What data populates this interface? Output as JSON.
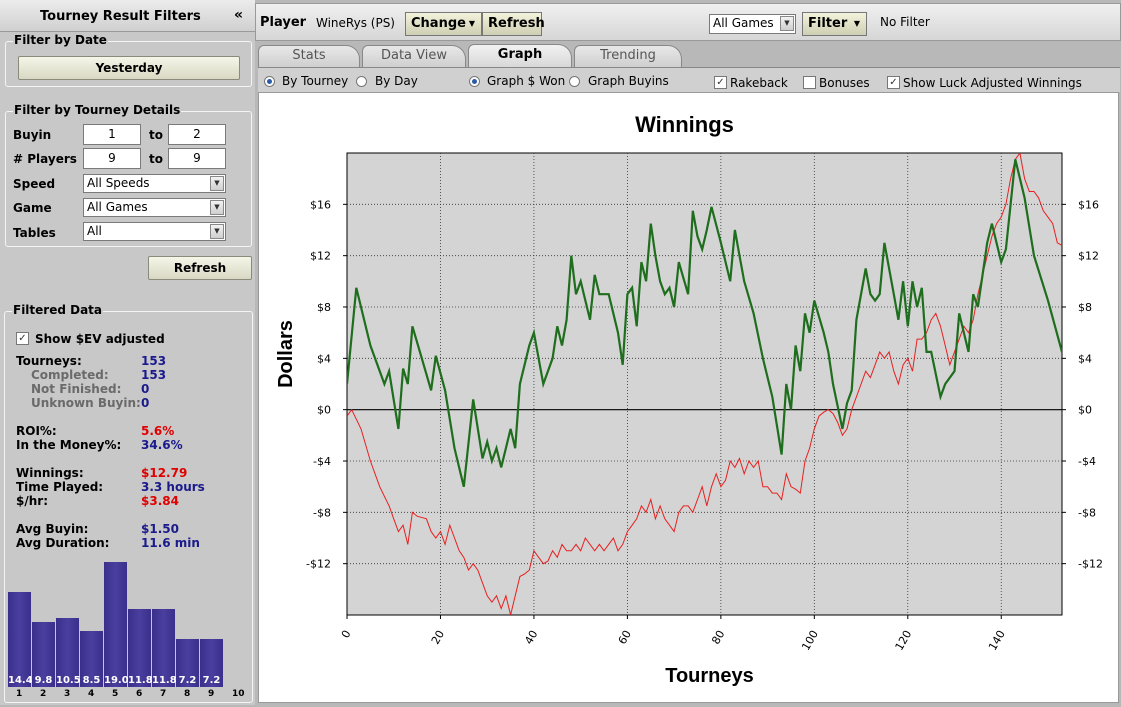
{
  "left_panel": {
    "title": "Tourney Result Filters",
    "collapse_glyph": "«",
    "filter_by_date": {
      "label": "Filter by Date",
      "button": "Yesterday"
    },
    "filter_by_details": {
      "label": "Filter by Tourney Details",
      "buyin": {
        "label": "Buyin",
        "from": "1",
        "to_label": "to",
        "to": "2"
      },
      "players": {
        "label": "# Players",
        "from": "9",
        "to_label": "to",
        "to": "9"
      },
      "speed": {
        "label": "Speed",
        "value": "All Speeds"
      },
      "game": {
        "label": "Game",
        "value": "All Games"
      },
      "tables": {
        "label": "Tables",
        "value": "All"
      }
    },
    "refresh": "Refresh",
    "filtered_data": {
      "label": "Filtered Data",
      "show_sev": "Show $EV adjusted",
      "show_sev_checked": true,
      "check_glyph": "✓",
      "tourneys_label": "Tourneys:",
      "tourneys": "153",
      "completed_label": "Completed:",
      "completed": "153",
      "not_finished_label": "Not Finished:",
      "not_finished": "0",
      "unknown_buyin_label": "Unknown Buyin:",
      "unknown_buyin": "0",
      "roi_label": "ROI%:",
      "roi": "5.6%",
      "itm_label": "In the Money%:",
      "itm": "34.6%",
      "winnings_label": "Winnings:",
      "winnings": "$12.79",
      "time_label": "Time Played:",
      "time": "3.3 hours",
      "hourly_label": "$/hr:",
      "hourly": "$3.84",
      "avg_buyin_label": "Avg Buyin:",
      "avg_buyin": "$1.50",
      "avg_duration_label": "Avg Duration:",
      "avg_duration": "11.6 min"
    },
    "finish_histogram": {
      "positions": [
        "1",
        "2",
        "3",
        "4",
        "5",
        "6",
        "7",
        "8",
        "9",
        "10"
      ],
      "values": [
        14.4,
        9.8,
        10.5,
        8.5,
        19.0,
        11.8,
        11.8,
        7.2,
        7.2,
        null
      ],
      "labels": [
        "14.4",
        "9.8",
        "10.5",
        "8.5",
        "19.0",
        "11.8",
        "11.8",
        "7.2",
        "7.2",
        ""
      ],
      "color": "#3d3290"
    }
  },
  "topbar": {
    "player_label": "Player",
    "player_value": "WineRys (PS)",
    "change": "Change",
    "refresh": "Refresh",
    "games_select": "All Games",
    "filter": "Filter",
    "filter_status": "No Filter",
    "dropdown_glyph": "▼"
  },
  "tabs": [
    {
      "label": "Stats",
      "active": false
    },
    {
      "label": "Data View",
      "active": false
    },
    {
      "label": "Graph",
      "active": true
    },
    {
      "label": "Trending",
      "active": false
    }
  ],
  "options": {
    "by_tourney": "By Tourney",
    "by_tourney_on": true,
    "by_day": "By Day",
    "by_day_on": false,
    "graph_won": "Graph $ Won",
    "graph_won_on": true,
    "graph_buyins": "Graph Buyins",
    "graph_buyins_on": false,
    "rakeback": "Rakeback",
    "rakeback_checked": true,
    "bonuses": "Bonuses",
    "bonuses_checked": false,
    "luck_adjusted": "Show Luck Adjusted Winnings",
    "luck_adjusted_checked": true,
    "check_glyph": "✓"
  },
  "chart_data": {
    "type": "line",
    "title": "Winnings",
    "xlabel": "Tourneys",
    "ylabel": "Dollars",
    "xlim": [
      0,
      153
    ],
    "ylim": [
      -16,
      20
    ],
    "x_ticks": [
      0,
      20,
      40,
      60,
      80,
      100,
      120,
      140
    ],
    "y_ticks": [
      -12,
      -8,
      -4,
      0,
      4,
      8,
      12,
      16
    ],
    "y_tick_labels": [
      "-$12",
      "-$8",
      "-$4",
      "$0",
      "$4",
      "$8",
      "$12",
      "$16"
    ],
    "grid": true,
    "background": "#d4d4d4",
    "series": [
      {
        "color": "#1e6e1e",
        "points": [
          [
            0,
            2
          ],
          [
            2,
            9.5
          ],
          [
            5,
            5
          ],
          [
            8,
            2
          ],
          [
            9,
            3
          ],
          [
            11,
            -1.5
          ],
          [
            12,
            3.2
          ],
          [
            13,
            2
          ],
          [
            14,
            6.5
          ],
          [
            16,
            4
          ],
          [
            18,
            1.5
          ],
          [
            19,
            4.2
          ],
          [
            21,
            1.5
          ],
          [
            23,
            -3
          ],
          [
            25,
            -6
          ],
          [
            27,
            0.8
          ],
          [
            29,
            -3.8
          ],
          [
            30,
            -2.5
          ],
          [
            31,
            -4
          ],
          [
            32,
            -3
          ],
          [
            33,
            -4.5
          ],
          [
            35,
            -1.5
          ],
          [
            36,
            -3
          ],
          [
            37,
            2
          ],
          [
            39,
            5
          ],
          [
            40,
            6
          ],
          [
            41,
            4
          ],
          [
            42,
            2
          ],
          [
            44,
            4
          ],
          [
            45,
            6.5
          ],
          [
            46,
            5
          ],
          [
            47,
            7
          ],
          [
            48,
            12
          ],
          [
            49,
            9
          ],
          [
            50,
            10
          ],
          [
            52,
            7
          ],
          [
            53,
            10.5
          ],
          [
            54,
            9
          ],
          [
            56,
            9
          ],
          [
            58,
            6
          ],
          [
            59,
            3.5
          ],
          [
            60,
            9
          ],
          [
            61,
            9.5
          ],
          [
            62,
            6.5
          ],
          [
            63,
            11.5
          ],
          [
            64,
            10
          ],
          [
            65,
            14.5
          ],
          [
            66,
            12
          ],
          [
            67,
            10
          ],
          [
            68,
            9
          ],
          [
            69,
            9.5
          ],
          [
            70,
            8
          ],
          [
            71,
            11.5
          ],
          [
            73,
            9
          ],
          [
            74,
            15.5
          ],
          [
            75,
            13.5
          ],
          [
            76,
            12.5
          ],
          [
            77,
            14
          ],
          [
            78,
            15.8
          ],
          [
            80,
            13
          ],
          [
            82,
            10
          ],
          [
            83,
            14
          ],
          [
            84,
            12
          ],
          [
            85,
            10
          ],
          [
            87,
            7.5
          ],
          [
            89,
            4
          ],
          [
            91,
            1
          ],
          [
            93,
            -3.5
          ],
          [
            94,
            2
          ],
          [
            95,
            0
          ],
          [
            96,
            5
          ],
          [
            97,
            3
          ],
          [
            98,
            7.5
          ],
          [
            99,
            6
          ],
          [
            100,
            8.5
          ],
          [
            102,
            6
          ],
          [
            103,
            4.5
          ],
          [
            104,
            2
          ],
          [
            106,
            -1.5
          ],
          [
            107,
            0.5
          ],
          [
            108,
            1.5
          ],
          [
            109,
            7
          ],
          [
            111,
            11
          ],
          [
            112,
            9
          ],
          [
            113,
            8.5
          ],
          [
            114,
            9
          ],
          [
            115,
            13
          ],
          [
            117,
            9
          ],
          [
            118,
            7
          ],
          [
            119,
            10
          ],
          [
            120,
            6.5
          ],
          [
            121,
            10
          ],
          [
            122,
            8
          ],
          [
            123,
            9.5
          ],
          [
            124,
            4.5
          ],
          [
            125,
            4.5
          ],
          [
            127,
            1
          ],
          [
            128,
            2
          ],
          [
            130,
            3
          ],
          [
            131,
            7.5
          ],
          [
            133,
            4.5
          ],
          [
            134,
            9
          ],
          [
            135,
            8
          ],
          [
            137,
            13
          ],
          [
            138,
            14.5
          ],
          [
            140,
            11.5
          ],
          [
            141,
            12.5
          ],
          [
            143,
            19.5
          ],
          [
            145,
            16.5
          ],
          [
            147,
            12
          ],
          [
            150,
            8.5
          ],
          [
            153,
            4.5
          ]
        ]
      },
      {
        "color": "#e82020",
        "points": [
          [
            0,
            -0.5
          ],
          [
            1,
            0
          ],
          [
            3,
            -1.5
          ],
          [
            5,
            -4
          ],
          [
            7,
            -6
          ],
          [
            9,
            -7.5
          ],
          [
            10,
            -8.5
          ],
          [
            11,
            -9.5
          ],
          [
            12,
            -9
          ],
          [
            13,
            -10.5
          ],
          [
            14,
            -8
          ],
          [
            15,
            -8.3
          ],
          [
            17,
            -8.5
          ],
          [
            18,
            -9.5
          ],
          [
            19,
            -10
          ],
          [
            20,
            -9.5
          ],
          [
            21,
            -10.5
          ],
          [
            22,
            -9
          ],
          [
            23,
            -10
          ],
          [
            24,
            -11
          ],
          [
            25,
            -11.5
          ],
          [
            26,
            -12.5
          ],
          [
            27,
            -12
          ],
          [
            28,
            -12.5
          ],
          [
            29,
            -13.5
          ],
          [
            30,
            -14.5
          ],
          [
            31,
            -15
          ],
          [
            32,
            -14.5
          ],
          [
            33,
            -15.5
          ],
          [
            34,
            -14.5
          ],
          [
            35,
            -16
          ],
          [
            36,
            -14.5
          ],
          [
            37,
            -13
          ],
          [
            38,
            -12.8
          ],
          [
            39,
            -12.5
          ],
          [
            40,
            -11
          ],
          [
            41,
            -11.5
          ],
          [
            42,
            -12
          ],
          [
            43,
            -11.8
          ],
          [
            44,
            -11
          ],
          [
            45,
            -11.5
          ],
          [
            46,
            -10.5
          ],
          [
            47,
            -11
          ],
          [
            48,
            -11
          ],
          [
            49,
            -10.5
          ],
          [
            50,
            -11
          ],
          [
            51,
            -10
          ],
          [
            52,
            -10.5
          ],
          [
            53,
            -11
          ],
          [
            54,
            -10.5
          ],
          [
            55,
            -11
          ],
          [
            56,
            -10.5
          ],
          [
            57,
            -10
          ],
          [
            58,
            -11
          ],
          [
            59,
            -10.5
          ],
          [
            60,
            -9.5
          ],
          [
            61,
            -9
          ],
          [
            62,
            -8.5
          ],
          [
            63,
            -7.5
          ],
          [
            64,
            -8
          ],
          [
            65,
            -7
          ],
          [
            66,
            -8.5
          ],
          [
            67,
            -7.5
          ],
          [
            68,
            -8.5
          ],
          [
            69,
            -9
          ],
          [
            70,
            -9.5
          ],
          [
            71,
            -8
          ],
          [
            72,
            -7.5
          ],
          [
            73,
            -7.5
          ],
          [
            74,
            -8
          ],
          [
            75,
            -7
          ],
          [
            76,
            -6
          ],
          [
            77,
            -7.5
          ],
          [
            78,
            -6
          ],
          [
            79,
            -5
          ],
          [
            80,
            -6
          ],
          [
            81,
            -5.5
          ],
          [
            82,
            -4
          ],
          [
            83,
            -4.5
          ],
          [
            84,
            -3.8
          ],
          [
            85,
            -5
          ],
          [
            86,
            -4
          ],
          [
            87,
            -4.5
          ],
          [
            88,
            -4
          ],
          [
            89,
            -6
          ],
          [
            90,
            -6
          ],
          [
            91,
            -6.5
          ],
          [
            92,
            -6.5
          ],
          [
            93,
            -7
          ],
          [
            94,
            -5
          ],
          [
            95,
            -6
          ],
          [
            96,
            -6.2
          ],
          [
            97,
            -6.5
          ],
          [
            98,
            -4
          ],
          [
            99,
            -3
          ],
          [
            100,
            -1.5
          ],
          [
            101,
            -0.5
          ],
          [
            102,
            -0.2
          ],
          [
            103,
            0
          ],
          [
            104,
            -0.3
          ],
          [
            105,
            -1
          ],
          [
            106,
            -2
          ],
          [
            107,
            -1.5
          ],
          [
            108,
            0
          ],
          [
            109,
            1
          ],
          [
            110,
            2
          ],
          [
            111,
            3
          ],
          [
            112,
            2.5
          ],
          [
            113,
            3.5
          ],
          [
            114,
            4.5
          ],
          [
            115,
            4
          ],
          [
            116,
            4.5
          ],
          [
            117,
            3
          ],
          [
            118,
            2
          ],
          [
            119,
            3.5
          ],
          [
            120,
            4
          ],
          [
            121,
            3
          ],
          [
            122,
            5.5
          ],
          [
            123,
            5.5
          ],
          [
            124,
            6
          ],
          [
            125,
            7
          ],
          [
            126,
            7.5
          ],
          [
            127,
            6.5
          ],
          [
            128,
            5
          ],
          [
            129,
            3.5
          ],
          [
            130,
            4.5
          ],
          [
            131,
            5.5
          ],
          [
            132,
            6.5
          ],
          [
            133,
            6
          ],
          [
            134,
            7
          ],
          [
            135,
            9
          ],
          [
            136,
            10.5
          ],
          [
            137,
            12
          ],
          [
            138,
            13.5
          ],
          [
            139,
            14.5
          ],
          [
            140,
            15
          ],
          [
            141,
            16
          ],
          [
            142,
            18
          ],
          [
            143,
            19.5
          ],
          [
            144,
            20
          ],
          [
            145,
            18
          ],
          [
            146,
            17
          ],
          [
            147,
            17
          ],
          [
            148,
            16.5
          ],
          [
            149,
            15.5
          ],
          [
            150,
            15
          ],
          [
            151,
            14.5
          ],
          [
            152,
            13
          ],
          [
            153,
            12.8
          ]
        ]
      }
    ]
  }
}
